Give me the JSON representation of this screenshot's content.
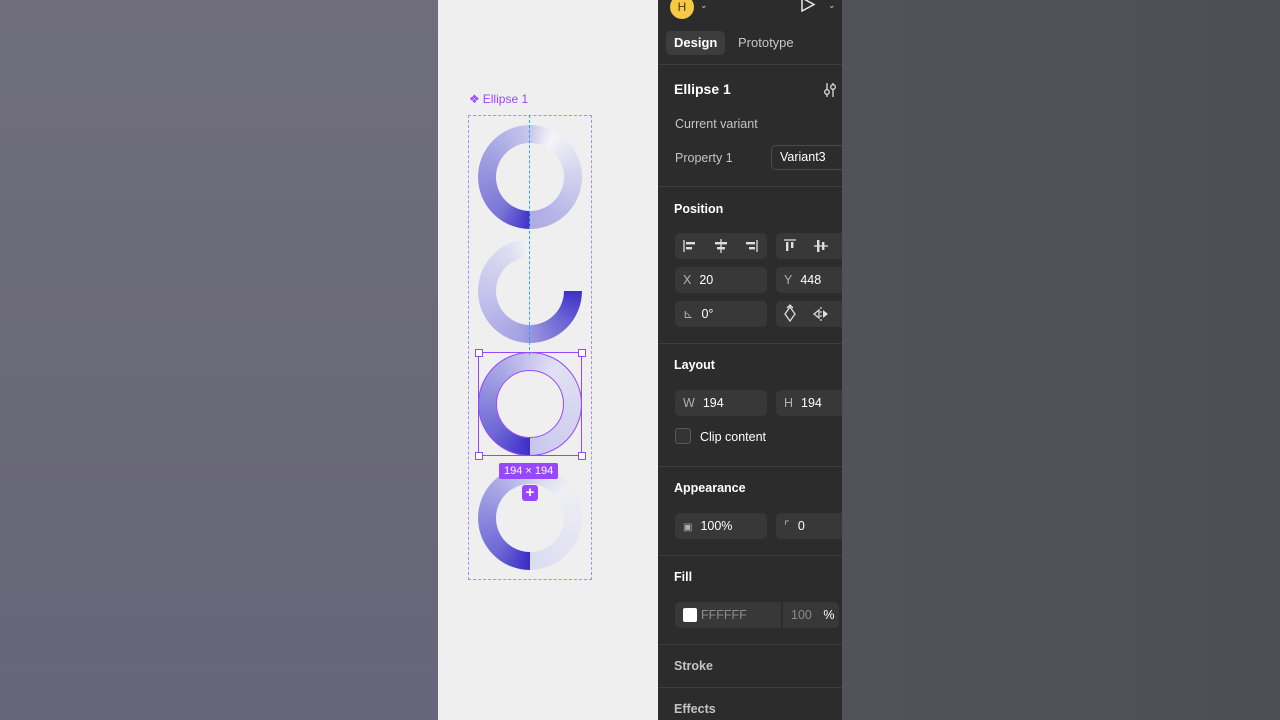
{
  "panel": {
    "avatar_initial": "H",
    "tabs": [
      {
        "label": "Design",
        "active": true
      },
      {
        "label": "Prototype",
        "active": false
      }
    ],
    "layer_name": "Ellipse 1",
    "current_variant_label": "Current variant",
    "property_label": "Property 1",
    "property_value": "Variant3",
    "position": {
      "title": "Position",
      "x_label": "X",
      "x_value": "20",
      "y_label": "Y",
      "y_value": "448",
      "rotation": "0°"
    },
    "layout": {
      "title": "Layout",
      "w_label": "W",
      "w_value": "194",
      "h_label": "H",
      "h_value": "194",
      "clip_content_label": "Clip content"
    },
    "appearance": {
      "title": "Appearance",
      "opacity": "100%",
      "radius": "0"
    },
    "fill": {
      "title": "Fill",
      "hex": "FFFFFF",
      "opacity": "100",
      "unit": "%"
    },
    "stroke_title": "Stroke",
    "effects_title": "Effects"
  },
  "canvas": {
    "component_label": "Ellipse 1",
    "size_badge": "194 × 194",
    "accent_color": "#9747ff",
    "ring_color": "#4031c9"
  }
}
